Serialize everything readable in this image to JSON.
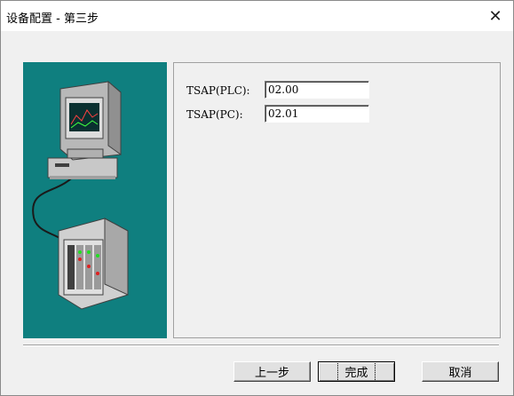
{
  "window": {
    "title": "设备配置 - 第三步",
    "close_glyph": "✕"
  },
  "form": {
    "fields": [
      {
        "label": "TSAP(PLC):",
        "value": "02.00"
      },
      {
        "label": "TSAP(PC):",
        "value": "02.01"
      }
    ]
  },
  "buttons": {
    "back": "上一步",
    "finish": "完成",
    "cancel": "取消"
  },
  "colors": {
    "art_background": "#0f7f7f",
    "dialog_background": "#f0f0f0"
  },
  "illustration": {
    "icons": [
      "computer-icon",
      "plc-rack-icon",
      "cable-icon"
    ]
  }
}
